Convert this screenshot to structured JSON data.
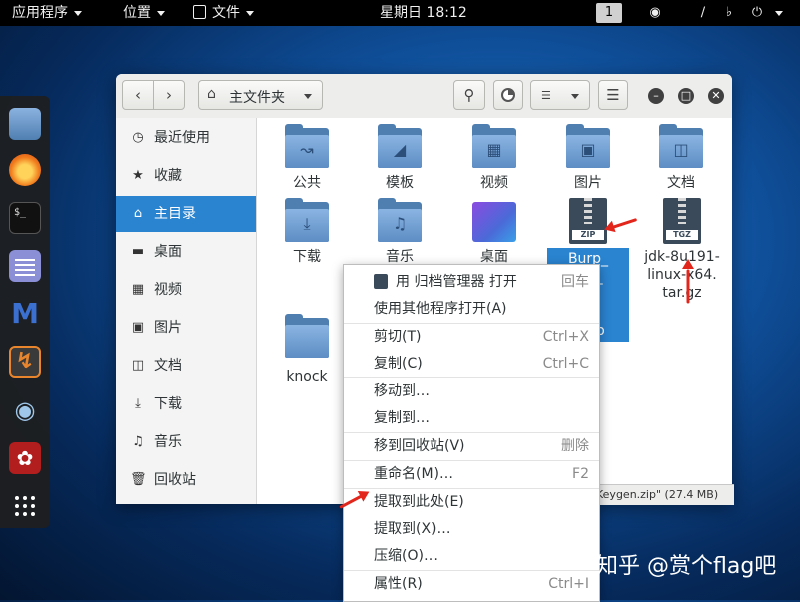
{
  "topbar": {
    "applications": "应用程序",
    "places": "位置",
    "file_menu": "文件",
    "clock": "星期日 18:12",
    "workspace": "1"
  },
  "window": {
    "location": "主文件夹"
  },
  "sidebar": {
    "items": [
      {
        "label": "最近使用",
        "icon": "clock-icon"
      },
      {
        "label": "收藏",
        "icon": "star-icon"
      },
      {
        "label": "主目录",
        "icon": "home-icon"
      },
      {
        "label": "桌面",
        "icon": "desktop-icon"
      },
      {
        "label": "视频",
        "icon": "film-icon"
      },
      {
        "label": "图片",
        "icon": "picture-icon"
      },
      {
        "label": "文档",
        "icon": "document-icon"
      },
      {
        "label": "下载",
        "icon": "download-icon"
      },
      {
        "label": "音乐",
        "icon": "music-icon"
      },
      {
        "label": "回收站",
        "icon": "trash-icon"
      }
    ]
  },
  "files": [
    {
      "label": "公共"
    },
    {
      "label": "模板"
    },
    {
      "label": "视频"
    },
    {
      "label": "图片"
    },
    {
      "label": "文档"
    },
    {
      "label": "下载"
    },
    {
      "label": "音乐"
    },
    {
      "label": "桌面"
    },
    {
      "label": "Burp_\nPro_\n7_\ner_\nn.zip",
      "tag": "ZIP"
    },
    {
      "label": "jdk-8u191-\nlinux-x64.\ntar.gz",
      "tag": "TGZ"
    },
    {
      "label": "knock"
    }
  ],
  "status": "Keygen.zip\" (27.4 MB)",
  "context_menu": [
    {
      "label": "用 归档管理器 打开",
      "shortcut": "回车"
    },
    {
      "label": "使用其他程序打开(A)",
      "shortcut": ""
    },
    {
      "label": "剪切(T)",
      "shortcut": "Ctrl+X"
    },
    {
      "label": "复制(C)",
      "shortcut": "Ctrl+C"
    },
    {
      "label": "移动到…",
      "shortcut": ""
    },
    {
      "label": "复制到…",
      "shortcut": ""
    },
    {
      "label": "移到回收站(V)",
      "shortcut": "删除"
    },
    {
      "label": "重命名(M)…",
      "shortcut": "F2"
    },
    {
      "label": "提取到此处(E)",
      "shortcut": ""
    },
    {
      "label": "提取到(X)…",
      "shortcut": ""
    },
    {
      "label": "压缩(O)…",
      "shortcut": ""
    },
    {
      "label": "属性(R)",
      "shortcut": "Ctrl+I"
    }
  ],
  "watermark": "知乎 @赏个flag吧",
  "colors": {
    "accent": "#2a84d0",
    "folder": "#5d8dc4",
    "annotation": "#e3261c"
  }
}
